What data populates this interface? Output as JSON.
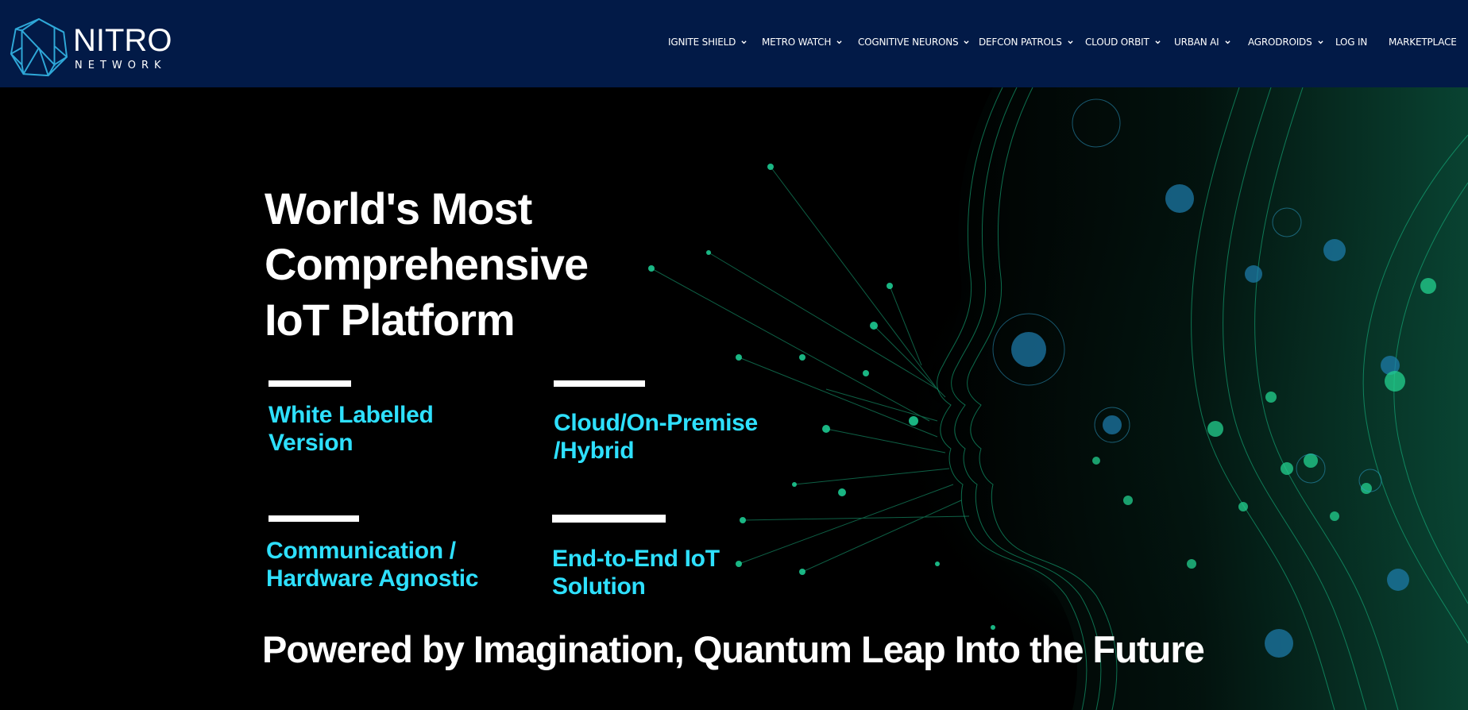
{
  "brand": {
    "name": "NITRO",
    "subname": "NETWORK",
    "icon": "nitro-hexagon-n-icon",
    "color": "#2fa8d8"
  },
  "nav": {
    "items": [
      {
        "label": "IGNITE SHIELD",
        "has_dropdown": true
      },
      {
        "label": "METRO WATCH",
        "has_dropdown": true
      },
      {
        "label": "COGNITIVE NEURONS",
        "has_dropdown": true
      },
      {
        "label": "DEFCON PATROLS",
        "has_dropdown": true
      },
      {
        "label": "CLOUD ORBIT",
        "has_dropdown": true
      },
      {
        "label": "URBAN AI",
        "has_dropdown": true
      },
      {
        "label": "AGRODROIDS",
        "has_dropdown": true
      },
      {
        "label": "LOG IN",
        "has_dropdown": false
      },
      {
        "label": "MARKETPLACE",
        "has_dropdown": false
      }
    ]
  },
  "hero": {
    "headline": [
      "World's Most",
      "Comprehensive",
      "IoT Platform"
    ],
    "features": [
      {
        "line1": "White Labelled",
        "line2": "Version"
      },
      {
        "line1": "Cloud/On-Premise",
        "line2": "/Hybrid"
      },
      {
        "line1": "Communication /",
        "line2": "Hardware Agnostic"
      },
      {
        "line1": "End-to-End IoT",
        "line2": "Solution"
      }
    ],
    "tagline": "Powered by Imagination, Quantum Leap Into the Future",
    "background": "ai-face-network-illustration"
  },
  "colors": {
    "header_bg": "#021a47",
    "accent": "#2ee0ff",
    "hero_green": "#16c98a"
  }
}
